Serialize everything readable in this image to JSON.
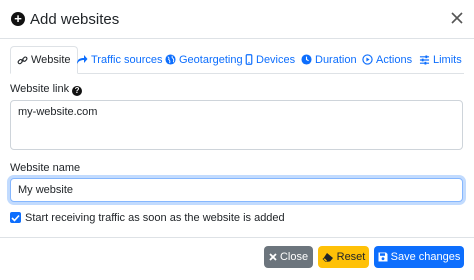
{
  "modal": {
    "title": "Add websites",
    "plus_icon": "plus-circle-icon",
    "close_icon": "close-icon"
  },
  "tabs": [
    {
      "label": "Website",
      "icon": "link-icon",
      "active": true
    },
    {
      "label": "Traffic sources",
      "icon": "share-arrow-icon",
      "active": false
    },
    {
      "label": "Geotargeting",
      "icon": "globe-icon",
      "active": false
    },
    {
      "label": "Devices",
      "icon": "mobile-icon",
      "active": false
    },
    {
      "label": "Duration",
      "icon": "clock-icon",
      "active": false
    },
    {
      "label": "Actions",
      "icon": "play-circle-icon",
      "active": false
    },
    {
      "label": "Limits",
      "icon": "sliders-icon",
      "active": false
    }
  ],
  "form": {
    "website_link_label": "Website link",
    "website_link_value": "my-website.com",
    "website_name_label": "Website name",
    "website_name_value": "My website",
    "start_traffic_label": "Start receiving traffic as soon as the website is added",
    "start_traffic_checked": true
  },
  "footer": {
    "close_label": "Close",
    "reset_label": "Reset",
    "save_label": "Save changes"
  },
  "colors": {
    "primary": "#0d6efd",
    "secondary": "#6c757d",
    "warning": "#ffc107",
    "border": "#dee2e6"
  }
}
